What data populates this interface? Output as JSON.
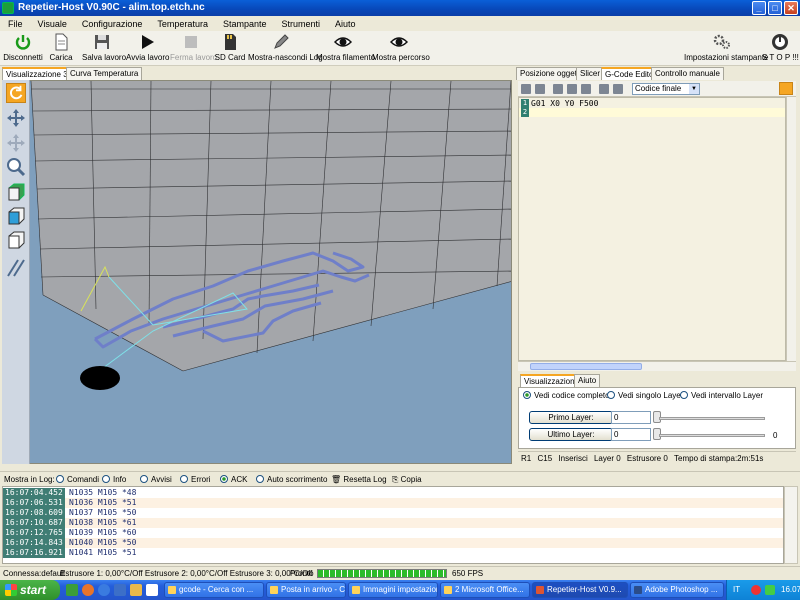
{
  "window": {
    "title": "Repetier-Host V0.90C - alim.top.etch.nc"
  },
  "menu": [
    "File",
    "Visuale",
    "Configurazione",
    "Temperatura",
    "Stampante",
    "Strumenti",
    "Aiuto"
  ],
  "toolbar": {
    "disconnect": "Disconnetti",
    "load": "Carica",
    "save_job": "Salva lavoro",
    "start_job": "Avvia lavoro",
    "stop_job": "Ferma lavoro",
    "sd_card": "SD Card",
    "toggle_log": "Mostra-nascondi Log",
    "show_filament": "Mostra filamento",
    "show_path": "Mostra percorso",
    "printer_settings": "Impostazioni stampante",
    "emergency_stop": "S T O P !!!"
  },
  "left_tabs": [
    "Visualizzazione 3D",
    "Curva Temperatura"
  ],
  "right_tabs": [
    "Posizione oggetto",
    "Slicer",
    "G-Code Editor",
    "Controllo manuale"
  ],
  "editor": {
    "code_select": "Codice finale",
    "lines": [
      {
        "num": "1",
        "text": "G01 X0 Y0 F500"
      },
      {
        "num": "2",
        "text": ""
      }
    ]
  },
  "vis_tabs": [
    "Visualizzazione",
    "Aiuto"
  ],
  "vis_options": {
    "full": "Vedi codice completo",
    "single": "Vedi singolo Layer",
    "range": "Vedi intervallo Layer",
    "first_layer_btn": "Primo Layer:",
    "last_layer_btn": "Ultimo Layer:",
    "first_layer_value": "0",
    "last_layer_value": "0",
    "slider_end_label": "0"
  },
  "editor_status": {
    "row": "R1",
    "col": "C15",
    "mode": "Inserisci",
    "layer": "Layer 0",
    "extruder": "Estrusore 0",
    "print_time": "Tempo di stampa:2m:51s"
  },
  "log": {
    "show_label": "Mostra in Log:",
    "filters": [
      "Comandi",
      "Info",
      "Avvisi",
      "Errori",
      "ACK",
      "Auto scorrimento"
    ],
    "reset": "Resetta Log",
    "copy": "Copia",
    "rows": [
      {
        "time": "16:07:04.452",
        "msg": "N1035 M105 *48"
      },
      {
        "time": "16:07:06.531",
        "msg": "N1036 M105 *51"
      },
      {
        "time": "16:07:08.609",
        "msg": "N1037 M105 *50"
      },
      {
        "time": "16:07:10.687",
        "msg": "N1038 M105 *61"
      },
      {
        "time": "16:07:12.765",
        "msg": "N1039 M105 *60"
      },
      {
        "time": "16:07:14.843",
        "msg": "N1040 M105 *50"
      },
      {
        "time": "16:07:16.921",
        "msg": "N1041 M105 *51"
      }
    ]
  },
  "status": {
    "connection": "Connessa:default",
    "extruders": "Estrusore 1: 0,00°C/Off Estrusore 2: 0,00°C/Off Estrusore 3: 0,00°C/Off",
    "ready": "Pronto",
    "fps": "650 FPS",
    "progress_fraction": 1.0
  },
  "taskbar": {
    "start": "start",
    "tasks": [
      "gcode - Cerca con ...",
      "Posta in arrivo - Ca...",
      "Immagini impostazioni",
      "2 Microsoft Office...",
      "Repetier-Host V0.9...",
      "Adobe Photoshop ..."
    ],
    "lang": "IT",
    "clock": "16.07"
  },
  "colors": {
    "accent": "#f5a623",
    "viewport_bg": "#7f9fbd",
    "log_time_bg": "#3f7d74",
    "path_color": "#6f7fc9"
  }
}
